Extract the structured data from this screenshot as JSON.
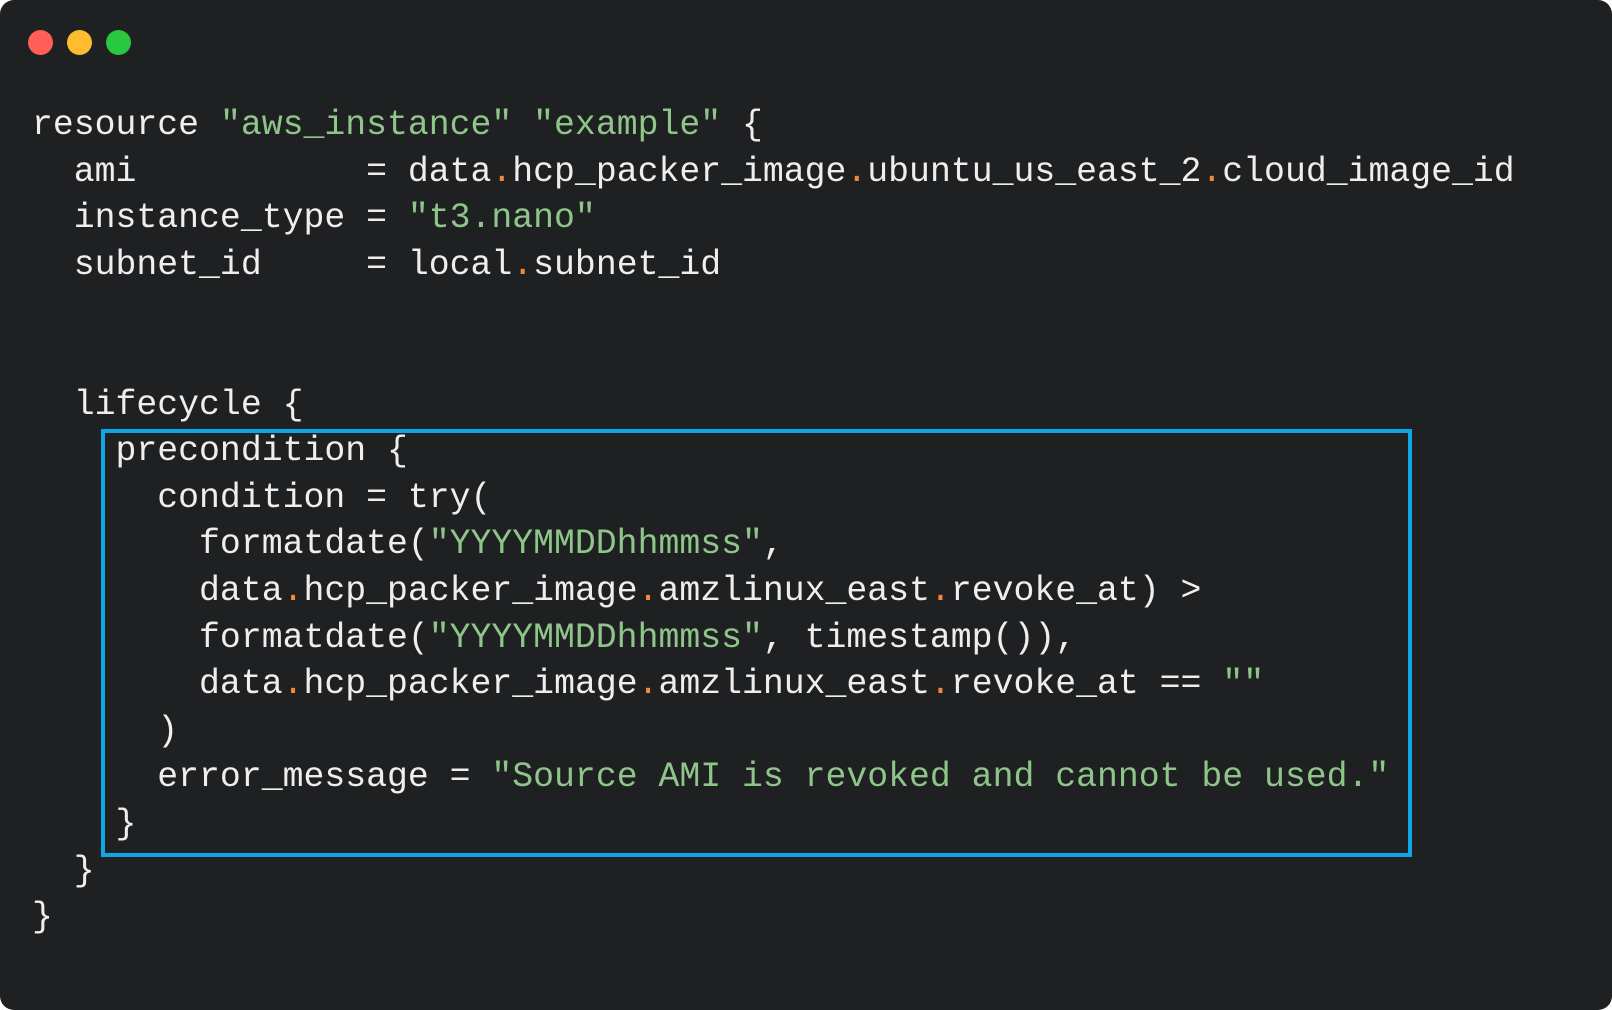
{
  "window": {
    "controls": [
      {
        "name": "close",
        "color": "#ff5f57"
      },
      {
        "name": "minimize",
        "color": "#febc2e"
      },
      {
        "name": "maximize",
        "color": "#28c840"
      }
    ]
  },
  "colors": {
    "background": "#1f2022",
    "text": "#eeeeee",
    "string": "#8fc58a",
    "accessor_dot": "#f0883e",
    "highlight_border": "#0ea5e9"
  },
  "code": {
    "language": "hcl",
    "lines": [
      [
        {
          "t": "resource "
        },
        {
          "t": "\"aws_instance\"",
          "k": "str"
        },
        {
          "t": " "
        },
        {
          "t": "\"example\"",
          "k": "str"
        },
        {
          "t": " {"
        }
      ],
      [
        {
          "t": "  ami           = data"
        },
        {
          "t": ".",
          "k": "dot"
        },
        {
          "t": "hcp_packer_image"
        },
        {
          "t": ".",
          "k": "dot"
        },
        {
          "t": "ubuntu_us_east_2"
        },
        {
          "t": ".",
          "k": "dot"
        },
        {
          "t": "cloud_image_id"
        }
      ],
      [
        {
          "t": "  instance_type = "
        },
        {
          "t": "\"t3.nano\"",
          "k": "str"
        }
      ],
      [
        {
          "t": "  subnet_id     = local"
        },
        {
          "t": ".",
          "k": "dot"
        },
        {
          "t": "subnet_id"
        }
      ],
      [
        {
          "t": ""
        }
      ],
      [
        {
          "t": ""
        }
      ],
      [
        {
          "t": "  lifecycle {"
        }
      ],
      [
        {
          "t": "    precondition {"
        }
      ],
      [
        {
          "t": "      condition = try("
        }
      ],
      [
        {
          "t": "        formatdate("
        },
        {
          "t": "\"YYYYMMDDhhmmss\"",
          "k": "str"
        },
        {
          "t": ","
        }
      ],
      [
        {
          "t": "        data"
        },
        {
          "t": ".",
          "k": "dot"
        },
        {
          "t": "hcp_packer_image"
        },
        {
          "t": ".",
          "k": "dot"
        },
        {
          "t": "amzlinux_east"
        },
        {
          "t": ".",
          "k": "dot"
        },
        {
          "t": "revoke_at) >"
        }
      ],
      [
        {
          "t": "        formatdate("
        },
        {
          "t": "\"YYYYMMDDhhmmss\"",
          "k": "str"
        },
        {
          "t": ", timestamp()),"
        }
      ],
      [
        {
          "t": "        data"
        },
        {
          "t": ".",
          "k": "dot"
        },
        {
          "t": "hcp_packer_image"
        },
        {
          "t": ".",
          "k": "dot"
        },
        {
          "t": "amzlinux_east"
        },
        {
          "t": ".",
          "k": "dot"
        },
        {
          "t": "revoke_at == "
        },
        {
          "t": "\"\"",
          "k": "str"
        }
      ],
      [
        {
          "t": "      )"
        }
      ],
      [
        {
          "t": "      error_message = "
        },
        {
          "t": "\"Source AMI is revoked and cannot be used.\"",
          "k": "str"
        }
      ],
      [
        {
          "t": "    }"
        }
      ],
      [
        {
          "t": "  }"
        }
      ],
      [
        {
          "t": "}"
        }
      ]
    ],
    "highlighted_block": "precondition"
  }
}
